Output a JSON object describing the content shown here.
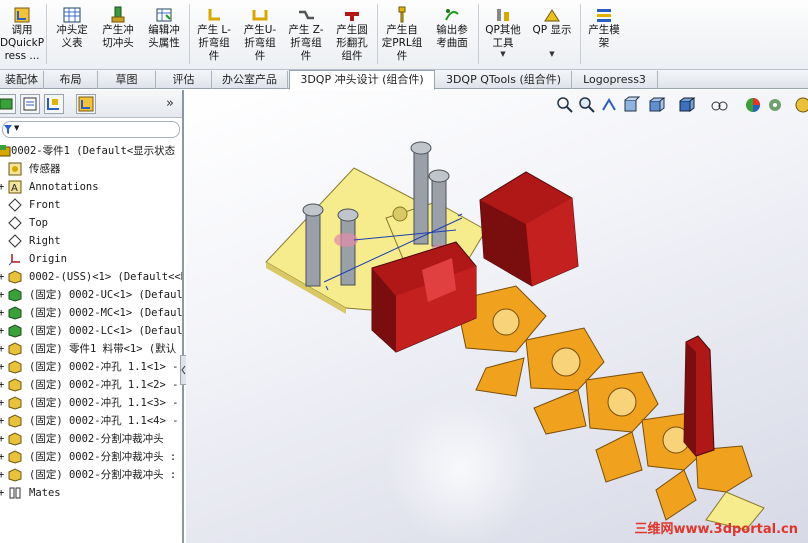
{
  "ribbon": {
    "items": [
      {
        "label": "调用\nDQuickP\nress ...",
        "icon": "quickpress-icon"
      },
      {
        "label": "冲头定\n义表",
        "icon": "table-icon"
      },
      {
        "label": "产生冲\n切冲头",
        "icon": "punch-icon"
      },
      {
        "label": "编辑冲\n头属性",
        "icon": "edit-punch-icon"
      },
      {
        "label": "产生 L-\n折弯组\n件",
        "icon": "l-bend-icon"
      },
      {
        "label": "产生U-\n折弯组\n件",
        "icon": "u-bend-icon"
      },
      {
        "label": "产生 Z-\n折弯组\n件",
        "icon": "z-bend-icon"
      },
      {
        "label": "产生圆\n形翻孔\n组件",
        "icon": "flange-icon"
      },
      {
        "label": "产生自\n定PRL组\n件",
        "icon": "prl-icon"
      },
      {
        "label": "输出参\n考曲面",
        "icon": "surface-icon"
      },
      {
        "label": "QP其他\n工具",
        "icon": "tools-icon"
      },
      {
        "label": "QP 显示",
        "icon": "display-icon"
      },
      {
        "label": "产生模\n架",
        "icon": "die-set-icon"
      }
    ]
  },
  "tabs": [
    {
      "label": "装配体"
    },
    {
      "label": "布局"
    },
    {
      "label": "草图"
    },
    {
      "label": "评估"
    },
    {
      "label": "办公室产品"
    },
    {
      "label": "3DQP 冲头设计 (组合件)"
    },
    {
      "label": "3DQP QTools (组合件)"
    },
    {
      "label": "Logopress3"
    }
  ],
  "active_tab": "3DQP 冲头设计 (组合件)",
  "pane": {
    "more_label": "»",
    "tree": [
      {
        "label": "0002-零件1  (Default<显示状态",
        "icon": "assembly-icon"
      },
      {
        "label": "传感器",
        "icon": "sensor-icon"
      },
      {
        "label": "Annotations",
        "icon": "annotation-icon"
      },
      {
        "label": "Front",
        "icon": "plane-icon"
      },
      {
        "label": "Top",
        "icon": "plane-icon"
      },
      {
        "label": "Right",
        "icon": "plane-icon"
      },
      {
        "label": "Origin",
        "icon": "origin-icon"
      },
      {
        "label": "0002-(USS)<1> (Default<<D",
        "icon": "part-icon"
      },
      {
        "label": "(固定) 0002-UC<1> (Defaul",
        "icon": "part-icon"
      },
      {
        "label": "(固定) 0002-MC<1> (Defaul",
        "icon": "part-icon"
      },
      {
        "label": "(固定) 0002-LC<1> (Defaul",
        "icon": "part-icon"
      },
      {
        "label": "(固定) 零件1 料带<1> (默认",
        "icon": "part-icon"
      },
      {
        "label": "(固定) 0002-冲孔 1.1<1> -",
        "icon": "part-icon"
      },
      {
        "label": "(固定) 0002-冲孔 1.1<2> -",
        "icon": "part-icon"
      },
      {
        "label": "(固定) 0002-冲孔 1.1<3> -",
        "icon": "part-icon"
      },
      {
        "label": "(固定) 0002-冲孔 1.1<4> -",
        "icon": "part-icon"
      },
      {
        "label": "(固定) 0002-分割冲裁冲头",
        "icon": "part-icon"
      },
      {
        "label": "(固定) 0002-分割冲裁冲头 :",
        "icon": "part-icon"
      },
      {
        "label": "(固定) 0002-分割冲裁冲头 :",
        "icon": "part-icon"
      },
      {
        "label": "Mates",
        "icon": "mates-icon"
      }
    ]
  },
  "watermark": "三维网www.3dportal.cn",
  "colors": {
    "accent": "#e0352b",
    "part_red": "#b01818",
    "strip_orange": "#f0a21e",
    "plate_yellow": "#f6ec8e"
  }
}
